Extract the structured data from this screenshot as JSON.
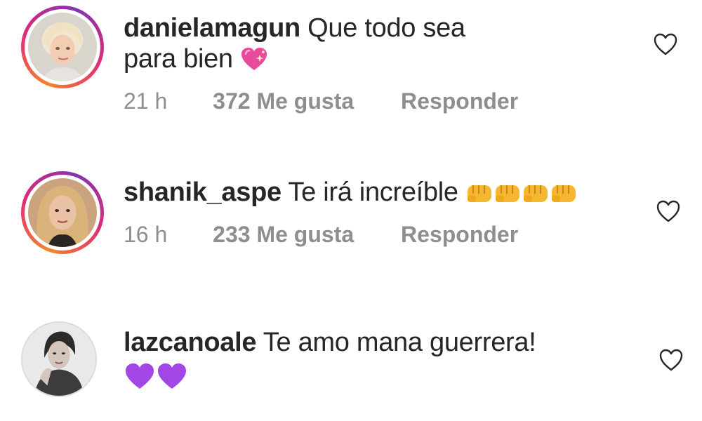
{
  "comments": [
    {
      "username": "danielamagun",
      "text_line1": "Que todo sea",
      "text_line2": "para bien",
      "emoji_icons": [
        "sparkling-heart-icon"
      ],
      "time": "21 h",
      "likes": "372 Me gusta",
      "reply": "Responder",
      "story_ring": true
    },
    {
      "username": "shanik_aspe",
      "text_line1": "Te irá increíble",
      "emoji_icons": [
        "fist-icon",
        "fist-icon",
        "fist-icon",
        "fist-icon"
      ],
      "time": "16 h",
      "likes": "233 Me gusta",
      "reply": "Responder",
      "story_ring": true
    },
    {
      "username": "lazcanoale",
      "text_line1": "Te amo mana guerrera!",
      "emoji_icons": [
        "purple-heart-icon",
        "purple-heart-icon"
      ],
      "story_ring": false
    }
  ],
  "icons": {
    "like": "heart-outline-icon"
  },
  "colors": {
    "secondary_text": "#8e8e8e",
    "primary_text": "#262626",
    "story_ring_start": "#f58529",
    "story_ring_end": "#dd2a7b"
  }
}
